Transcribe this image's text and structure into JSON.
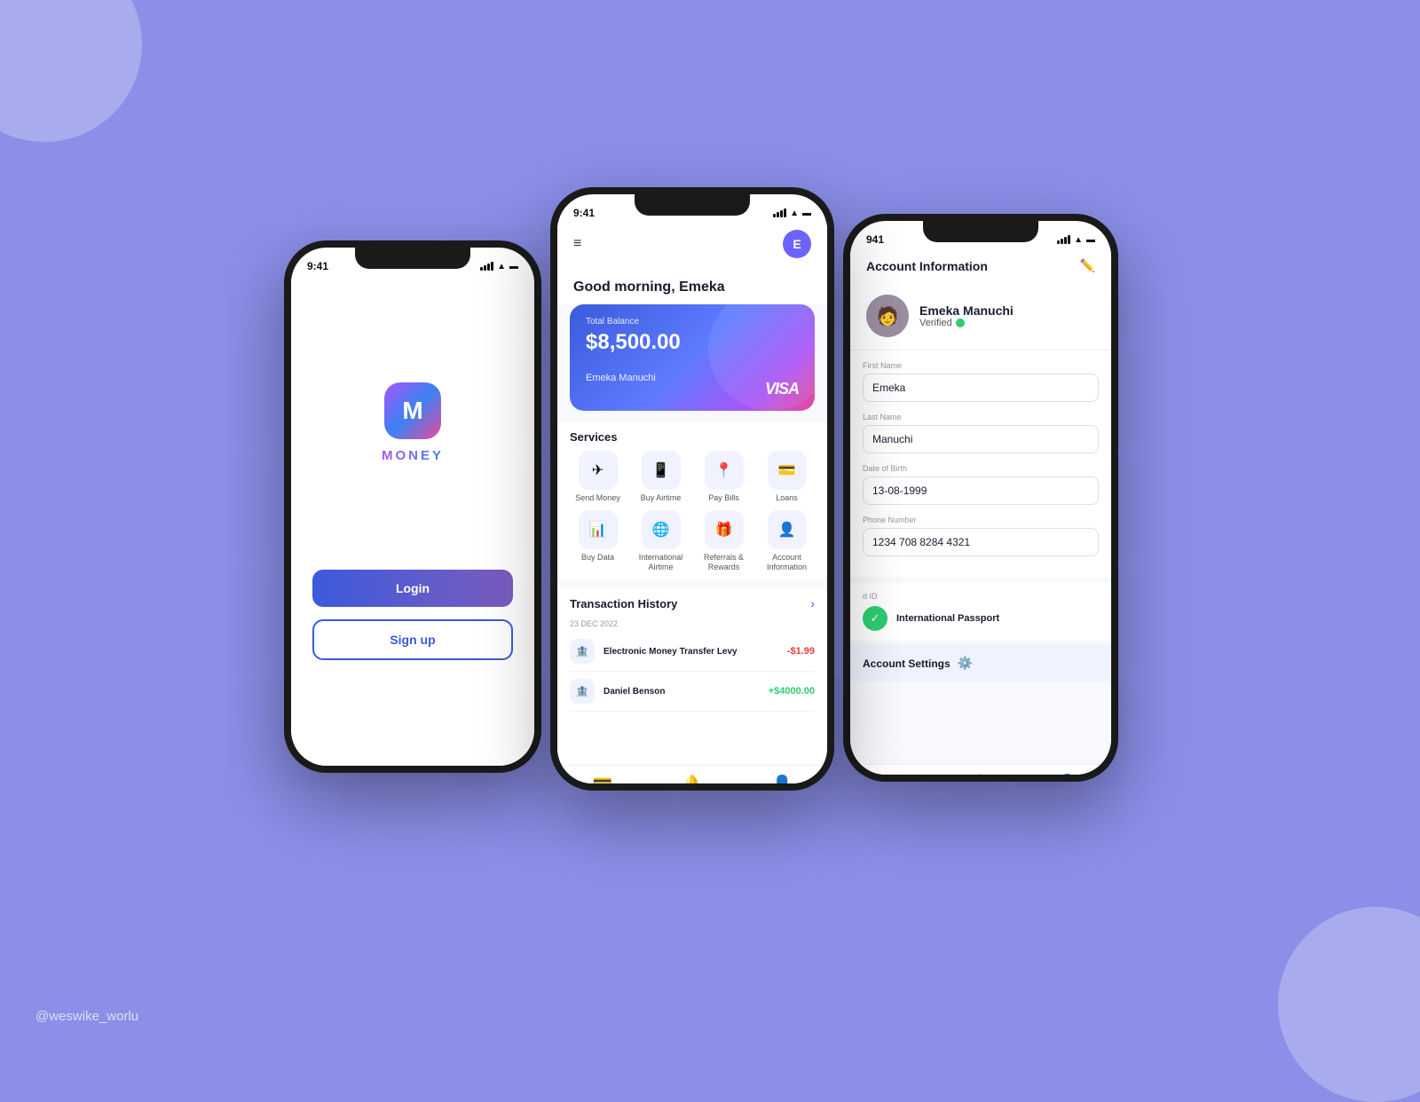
{
  "background": {
    "color": "#8b8fe8"
  },
  "watermark": "@weswike_worlu",
  "phone_left": {
    "status_time": "9:41",
    "logo_letter": "M",
    "logo_text": "MONEY",
    "btn_login": "Login",
    "btn_signup": "Sign up"
  },
  "phone_center": {
    "status_time": "9:41",
    "greeting": "Good morning, Emeka",
    "balance_label": "Total Balance",
    "balance_amount": "$8,500.00",
    "cardholder": "Emeka Manuchi",
    "card_network": "VISA",
    "services_title": "Services",
    "services": [
      {
        "label": "Send Money",
        "icon": "✈"
      },
      {
        "label": "Buy Airtime",
        "icon": "📱"
      },
      {
        "label": "Pay Bills",
        "icon": "📍"
      },
      {
        "label": "Loans",
        "icon": "💳"
      },
      {
        "label": "Buy Data",
        "icon": "📊"
      },
      {
        "label": "International Airtime",
        "icon": "🌐"
      },
      {
        "label": "Referrals & Rewards",
        "icon": "🎁"
      },
      {
        "label": "Account Information",
        "icon": "👤"
      }
    ],
    "txn_title": "Transaction History",
    "txn_date": "23 DEC 2022",
    "transactions": [
      {
        "name": "Electronic Money Transfer Levy",
        "amount": "-$1.99",
        "type": "negative",
        "icon": "🏦"
      },
      {
        "name": "Daniel Benson",
        "amount": "+$4000.00",
        "type": "positive",
        "icon": "🏦"
      }
    ]
  },
  "phone_right": {
    "status_time": "941",
    "title": "Account Information",
    "user_name": "Emeka Manuchi",
    "verified_text": "Verified",
    "fields": [
      {
        "label": "First Name",
        "value": "Emeka"
      },
      {
        "label": "Last Name",
        "value": "Manuchi"
      },
      {
        "label": "Date of Birth",
        "value": "13-08-1999"
      },
      {
        "label": "Phone Number",
        "value": "1234 708 8284 4321"
      }
    ],
    "id_label": "d ID",
    "id_type": "International Passport",
    "settings_label": "Account Settings"
  }
}
